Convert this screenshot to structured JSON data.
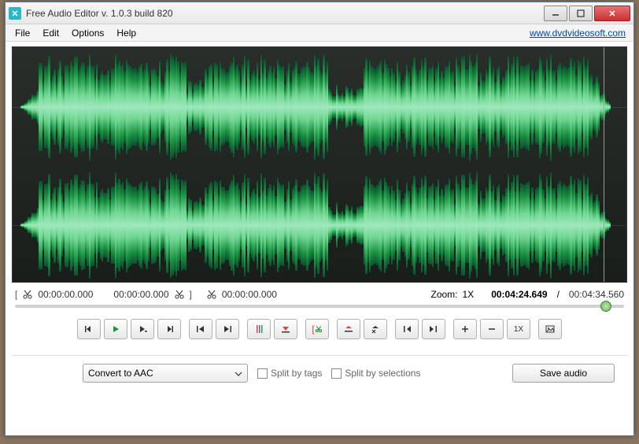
{
  "window": {
    "title": "Free Audio Editor v. 1.0.3 build 820"
  },
  "menu": {
    "items": [
      "File",
      "Edit",
      "Options",
      "Help"
    ],
    "link": "www.dvdvideosoft.com"
  },
  "times": {
    "sel_start": "00:00:00.000",
    "sel_end": "00:00:00.000",
    "cut_pos": "00:00:00.000",
    "zoom_label": "Zoom:",
    "zoom_value": "1X",
    "current": "00:04:24.649",
    "sep": "/",
    "total": "00:04:34.560"
  },
  "toolbar": {
    "zoom_reset": "1X"
  },
  "bottom": {
    "convert_label": "Convert to AAC",
    "split_tags": "Split by tags",
    "split_sel": "Split by selections",
    "save": "Save audio"
  }
}
